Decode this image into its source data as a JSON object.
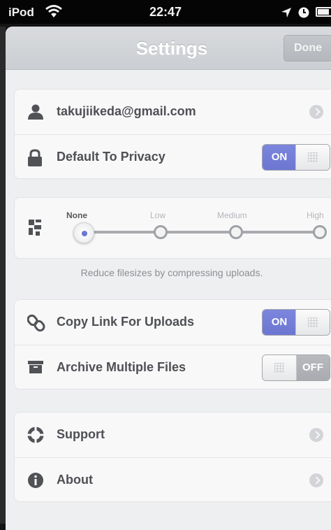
{
  "status_bar": {
    "carrier": "iPod",
    "time": "22:47"
  },
  "nav": {
    "title": "Settings",
    "done_label": "Done"
  },
  "account": {
    "email": "takujiikeda@gmail.com",
    "privacy_label": "Default To Privacy",
    "privacy_state": "ON"
  },
  "compression": {
    "levels": [
      "None",
      "Low",
      "Medium",
      "High"
    ],
    "selected": "None",
    "footnote": "Reduce filesizes by compressing uploads."
  },
  "upload_options": {
    "copy_link_label": "Copy Link For Uploads",
    "copy_link_state": "ON",
    "archive_label": "Archive Multiple Files",
    "archive_state": "OFF"
  },
  "info": {
    "support_label": "Support",
    "about_label": "About"
  },
  "colors": {
    "accent": "#6c76d2",
    "background": "#eeeff1"
  }
}
